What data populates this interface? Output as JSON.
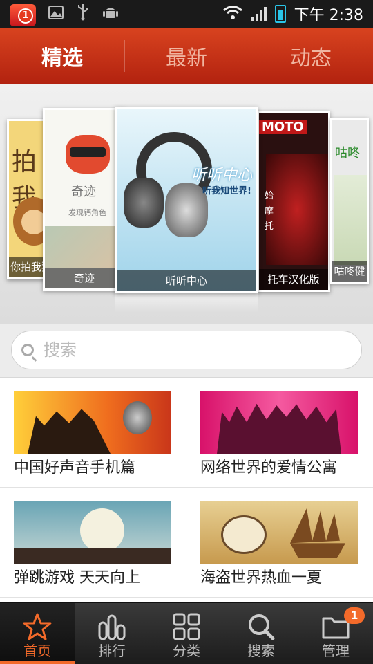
{
  "status_bar": {
    "app_badge_count": "1",
    "time": "下午 2:38"
  },
  "tabs": [
    {
      "label": "精选",
      "active": true
    },
    {
      "label": "最新",
      "active": false
    },
    {
      "label": "动态",
      "active": false
    }
  ],
  "carousel": {
    "cards": [
      {
        "title": "你拍我猜",
        "image_text": "拍我"
      },
      {
        "title": "奇迹",
        "image_text": "奇迹",
        "sub_text": "发现钙角色"
      },
      {
        "title": "听听中心",
        "image_text": "听听中心",
        "image_sub_text": "听我知世界!"
      },
      {
        "title": "托车汉化版",
        "image_text": "MOTO",
        "side_text": "始摩托"
      },
      {
        "title": "咕咚健身",
        "image_text": "咕咚"
      }
    ]
  },
  "search": {
    "placeholder": "搜索"
  },
  "topics": [
    {
      "title": "中国好声音手机篇",
      "image": "singers-and-microphone"
    },
    {
      "title": "网络世界的爱情公寓",
      "image": "crowd-silhouettes-pink"
    },
    {
      "title": "弹跳游戏 天天向上",
      "image": "ninja-moon-rooftops"
    },
    {
      "title": "海盗世界热血一夏",
      "image": "pirate-skull-ship"
    }
  ],
  "bottom_nav": [
    {
      "label": "首页",
      "icon": "star-icon",
      "active": true
    },
    {
      "label": "排行",
      "icon": "ranking-bars-icon",
      "active": false
    },
    {
      "label": "分类",
      "icon": "category-grid-icon",
      "active": false
    },
    {
      "label": "搜索",
      "icon": "search-icon",
      "active": false
    },
    {
      "label": "管理",
      "icon": "folder-icon",
      "active": false,
      "badge": "1"
    }
  ],
  "colors": {
    "header_red": "#c8321a",
    "accent_orange": "#f36a2a",
    "nav_dark": "#2a2a2a"
  }
}
